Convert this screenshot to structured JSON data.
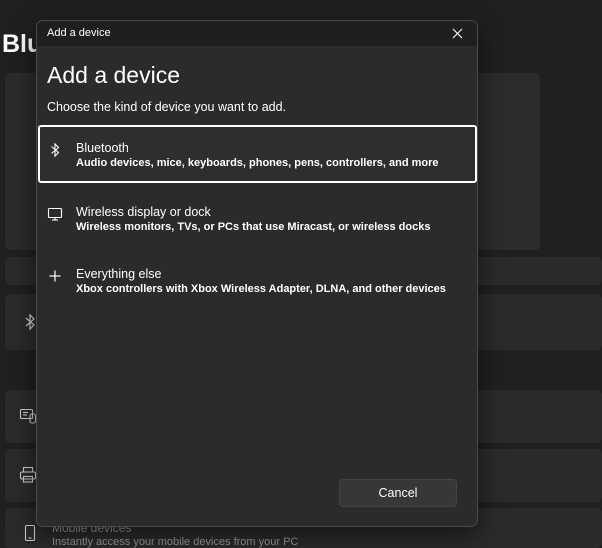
{
  "background": {
    "title": "Bluetooth & devices",
    "mobile_devices_title": "Mobile devices",
    "mobile_devices_subtitle": "Instantly access your mobile devices from your PC"
  },
  "dialog": {
    "window_title": "Add a device",
    "heading": "Add a device",
    "subtitle": "Choose the kind of device you want to add.",
    "options": [
      {
        "icon": "bluetooth-icon",
        "title": "Bluetooth",
        "description": "Audio devices, mice, keyboards, phones, pens, controllers, and more",
        "selected": true
      },
      {
        "icon": "monitor-icon",
        "title": "Wireless display or dock",
        "description": "Wireless monitors, TVs, or PCs that use Miracast, or wireless docks",
        "selected": false
      },
      {
        "icon": "plus-icon",
        "title": "Everything else",
        "description": "Xbox controllers with Xbox Wireless Adapter, DLNA, and other devices",
        "selected": false
      }
    ],
    "cancel_label": "Cancel"
  },
  "colors": {
    "dialog_background": "#2b2b2b",
    "titlebar_background": "#1f1f1f",
    "selection_border": "#ffffff",
    "page_background": "#202020"
  }
}
